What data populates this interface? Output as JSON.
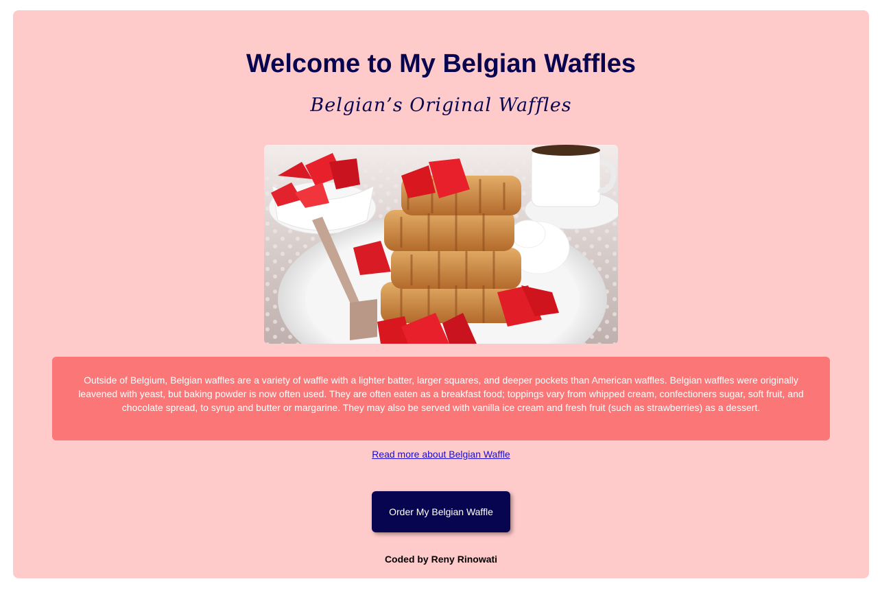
{
  "header": {
    "title": "Welcome to My Belgian Waffles",
    "subtitle": "Belgian’s Original Waffles"
  },
  "hero_image": {
    "alt": "Stack of Belgian waffles topped with strawberries, with whipped cream, a fork and a cup of coffee"
  },
  "description": {
    "text": "Outside of Belgium, Belgian waffles are a variety of waffle with a lighter batter, larger squares, and deeper pockets than American waffles. Belgian waffles were originally leavened with yeast, but baking powder is now often used. They are often eaten as a breakfast food; toppings vary from whipped cream, confectioners sugar, soft fruit, and chocolate spread, to syrup and butter or margarine. They may also be served with vanilla ice cream and fresh fruit (such as strawberries) as a dessert."
  },
  "links": {
    "read_more_label": "Read more about Belgian Waffle"
  },
  "actions": {
    "order_label": "Order My Belgian Waffle"
  },
  "footer": {
    "credit": "Coded by Reny Rinowati"
  },
  "colors": {
    "page_background": "#ffffff",
    "card_background": "#ffcaca",
    "description_background": "#fb7676",
    "heading_color": "#07054f",
    "button_background": "#07054f",
    "link_color": "#1a0dcc"
  },
  "icons": [
    "waffle-photo"
  ]
}
